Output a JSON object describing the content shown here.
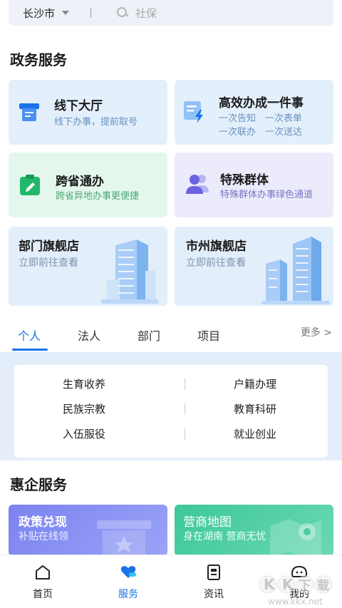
{
  "search": {
    "city": "长沙市",
    "placeholder": "社保"
  },
  "gov_section": {
    "title": "政务服务",
    "cards": [
      {
        "title": "线下大厅",
        "subtitle": "线下办事，提前取号",
        "icon": "ticket-machine-icon"
      },
      {
        "title": "高效办成一件事",
        "subtitle_lines": [
          "一次告知　一次表单",
          "一次联办　一次送达"
        ],
        "icon": "lightning-doc-icon"
      },
      {
        "title": "跨省通办",
        "subtitle": "跨省异地办事更便捷",
        "icon": "clipboard-edit-icon"
      },
      {
        "title": "特殊群体",
        "subtitle": "特殊群体办事绿色通道",
        "icon": "group-users-icon"
      },
      {
        "title": "部门旗舰店",
        "subtitle": "立即前往查看",
        "icon": "building-icon"
      },
      {
        "title": "市州旗舰店",
        "subtitle": "立即前往查看",
        "icon": "city-buildings-icon"
      }
    ]
  },
  "tabs": {
    "items": [
      "个人",
      "法人",
      "部门",
      "项目"
    ],
    "active": "个人",
    "more": "更多 >"
  },
  "categories": {
    "rows": [
      [
        "生育收养",
        "户籍办理"
      ],
      [
        "民族宗教",
        "教育科研"
      ],
      [
        "入伍服役",
        "就业创业"
      ]
    ]
  },
  "biz_section": {
    "title": "惠企服务",
    "cards": [
      {
        "title": "政策兑现",
        "subtitle": "补贴在线领",
        "icon": "star-box-icon"
      },
      {
        "title": "营商地图",
        "subtitle": "身在湖南 营商无忧",
        "icon": "map-pin-icon"
      }
    ]
  },
  "bottom_nav": {
    "items": [
      {
        "label": "首页",
        "icon": "home-icon"
      },
      {
        "label": "服务",
        "icon": "heart-hand-icon"
      },
      {
        "label": "资讯",
        "icon": "news-icon"
      },
      {
        "label": "我的",
        "icon": "profile-icon"
      }
    ],
    "active": "服务"
  },
  "watermark": {
    "text": "KK下载",
    "url": "www.kkx.net"
  },
  "colors": {
    "accent": "#1a73e8",
    "tab_active": "#1a73e8"
  }
}
